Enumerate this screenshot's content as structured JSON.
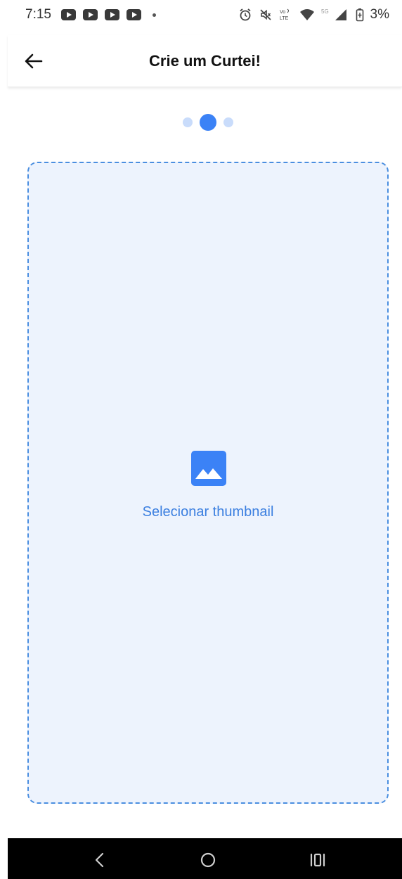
{
  "status_bar": {
    "time": "7:15",
    "notification_icons": [
      "youtube-icon",
      "youtube-icon",
      "youtube-icon",
      "youtube-icon"
    ],
    "network_label": "5G",
    "battery": "3%"
  },
  "app_bar": {
    "title": "Crie um Curtei!"
  },
  "stepper": {
    "total_steps": 3,
    "current_step": 2
  },
  "upload": {
    "label": "Selecionar thumbnail",
    "icon": "image-icon"
  },
  "colors": {
    "accent": "#3b82f6",
    "dropzone_bg": "#edf3fd",
    "dropzone_border": "#4a8ee0"
  }
}
